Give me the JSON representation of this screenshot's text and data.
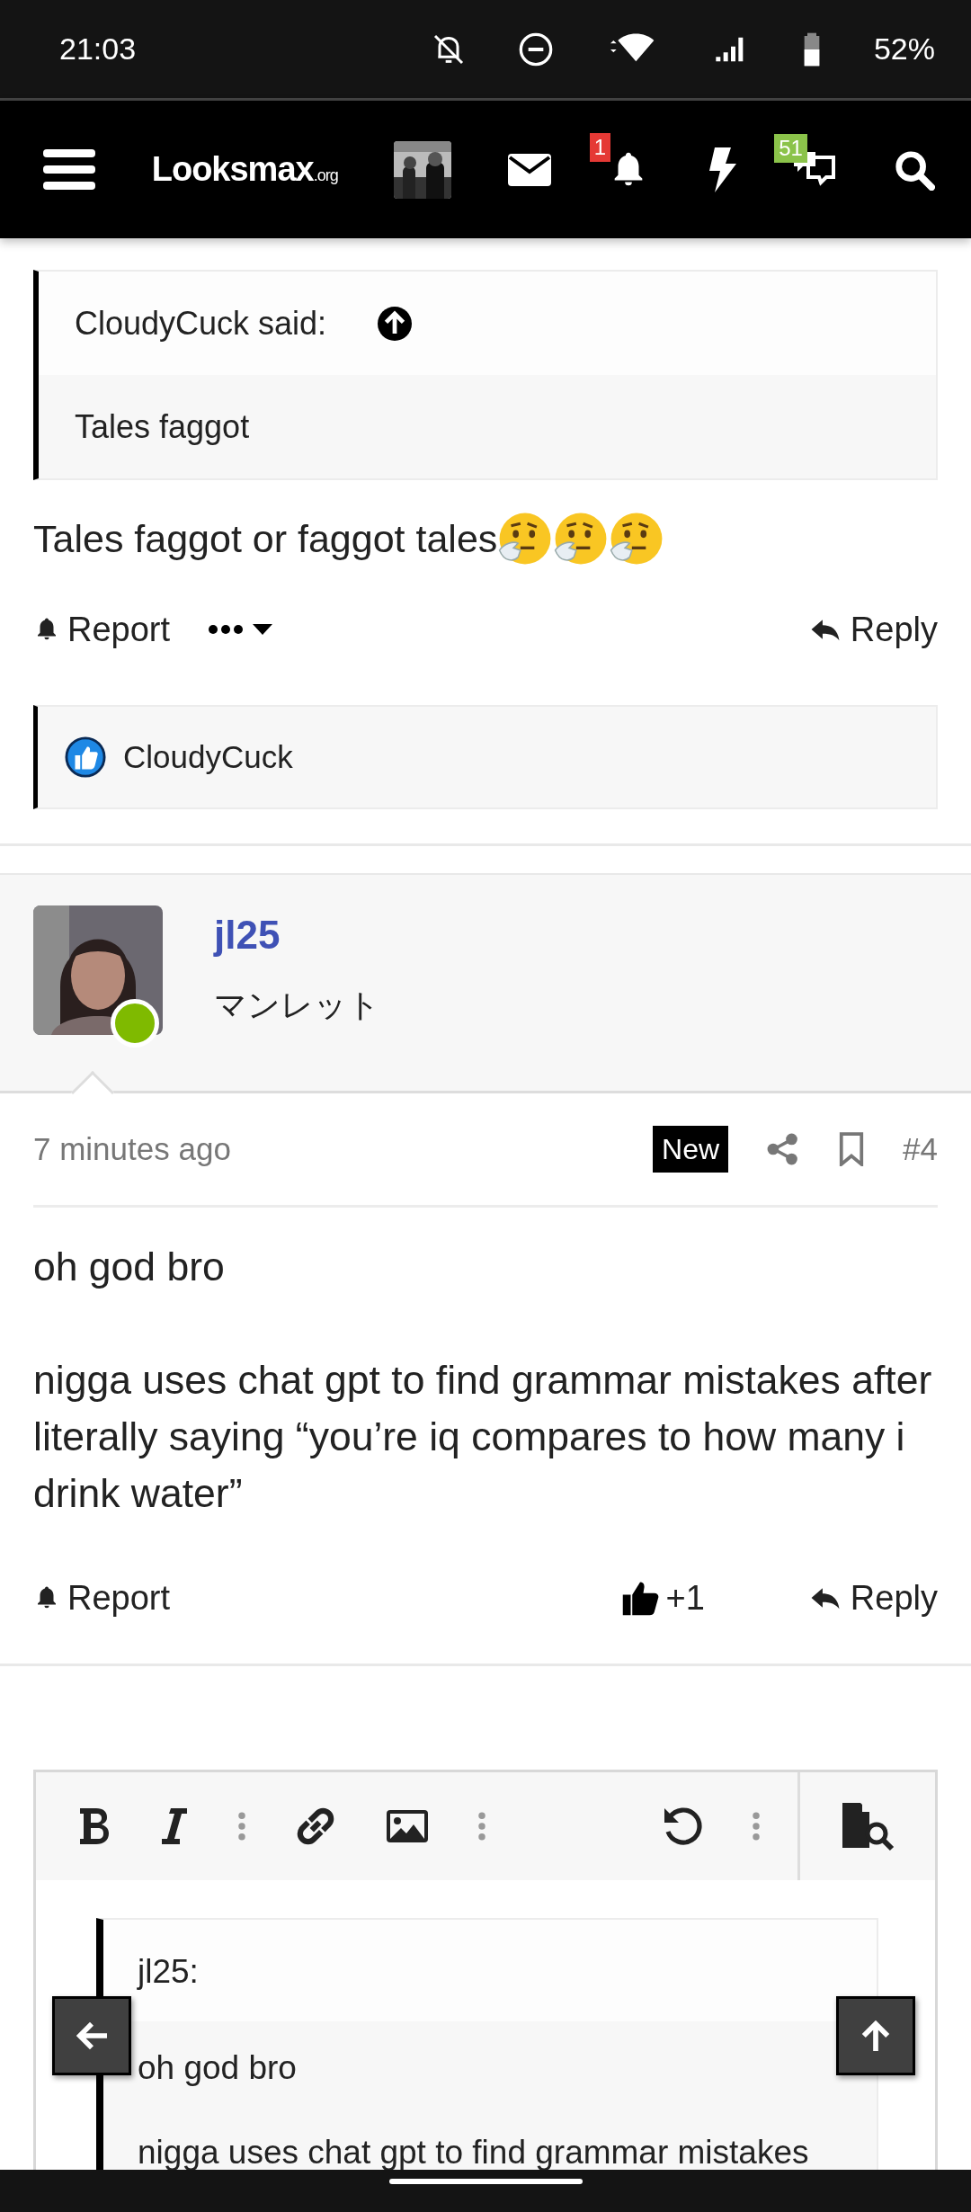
{
  "status_bar": {
    "time": "21:03",
    "battery": "52%"
  },
  "navbar": {
    "logo": "Looksmax",
    "logo_suffix": ".org",
    "alerts_badge": "1",
    "conversations_badge": "51"
  },
  "post_1": {
    "quote": {
      "author": "CloudyCuck said:",
      "text": "Tales faggot"
    },
    "body": "Tales faggot or faggot tales",
    "actions": {
      "report": "Report",
      "reply": "Reply"
    },
    "reactions": {
      "users": "CloudyCuck"
    }
  },
  "post_2": {
    "user": {
      "name": "jl25",
      "title": "マンレット",
      "online": true
    },
    "time": "7 minutes ago",
    "new_label": "New",
    "number": "#4",
    "paragraphs": [
      "oh god bro",
      "nigga uses chat gpt to find grammar mistakes after literally saying “you’re iq compares to how many i drink water”"
    ],
    "actions": {
      "report": "Report",
      "like_count": "+1",
      "reply": "Reply"
    }
  },
  "editor": {
    "quote_author": "jl25:",
    "paragraphs": [
      "oh god bro",
      "nigga uses chat gpt to find grammar mistakes"
    ]
  }
}
